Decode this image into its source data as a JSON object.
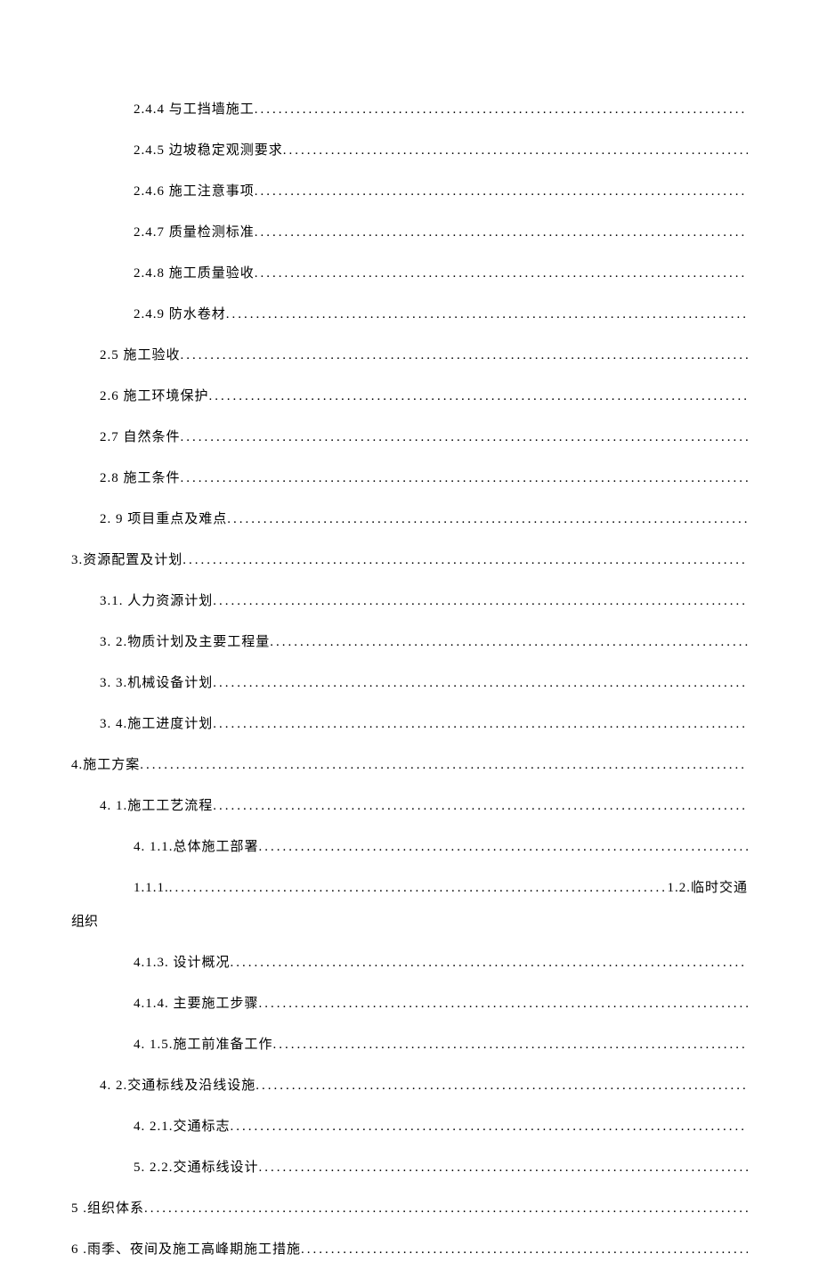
{
  "toc": [
    {
      "indent": 2,
      "prefix": "2.4.4 与工挡墙施工",
      "suffix": ""
    },
    {
      "indent": 2,
      "prefix": "2.4.5 边坡稳定观测要求",
      "suffix": ""
    },
    {
      "indent": 2,
      "prefix": "2.4.6 施工注意事项",
      "suffix": ""
    },
    {
      "indent": 2,
      "prefix": "2.4.7 质量检测标准",
      "suffix": ""
    },
    {
      "indent": 2,
      "prefix": "2.4.8 施工质量验收",
      "suffix": ""
    },
    {
      "indent": 2,
      "prefix": "2.4.9 防水卷材",
      "suffix": ""
    },
    {
      "indent": 1,
      "prefix": "2.5 施工验收",
      "suffix": ""
    },
    {
      "indent": 1,
      "prefix": "2.6 施工环境保护",
      "suffix": ""
    },
    {
      "indent": 1,
      "prefix": "2.7 自然条件",
      "suffix": ""
    },
    {
      "indent": 1,
      "prefix": "2.8 施工条件",
      "suffix": ""
    },
    {
      "indent": 1,
      "prefix": "2.  9 项目重点及难点",
      "suffix": ""
    },
    {
      "indent": 0,
      "prefix": "3.资源配置及计划",
      "suffix": ""
    },
    {
      "indent": 1,
      "prefix": "3.1.   人力资源计划",
      "suffix": ""
    },
    {
      "indent": 1,
      "prefix": "3.  2.物质计划及主要工程量",
      "suffix": ""
    },
    {
      "indent": 1,
      "prefix": "3.  3.机械设备计划",
      "suffix": ""
    },
    {
      "indent": 1,
      "prefix": "3.  4.施工进度计划",
      "suffix": ""
    },
    {
      "indent": 0,
      "prefix": "4.施工方案",
      "suffix": ""
    },
    {
      "indent": 1,
      "prefix": "4.  1.施工工艺流程",
      "suffix": ""
    },
    {
      "indent": 2,
      "prefix": "4.  1.1.总体施工部署",
      "suffix": ""
    },
    {
      "indent": 2,
      "prefix": "1.1.1. ",
      "suffix": "1.2.临时交通",
      "wrap": "组织"
    },
    {
      "indent": 2,
      "prefix": "4.1.3.   设计概况",
      "suffix": ""
    },
    {
      "indent": 2,
      "prefix": "4.1.4.   主要施工步骤",
      "suffix": ""
    },
    {
      "indent": 2,
      "prefix": "4.  1.5.施工前准备工作",
      "suffix": ""
    },
    {
      "indent": 1,
      "prefix": "4.  2.交通标线及沿线设施",
      "suffix": ""
    },
    {
      "indent": 2,
      "prefix": "4.  2.1.交通标志",
      "suffix": ""
    },
    {
      "indent": 2,
      "prefix": "5.  2.2.交通标线设计",
      "suffix": ""
    },
    {
      "indent": 0,
      "prefix": "5  .组织体系",
      "suffix": ""
    },
    {
      "indent": 0,
      "prefix": "6  .雨季、夜间及施工高峰期施工措施",
      "suffix": ""
    }
  ]
}
